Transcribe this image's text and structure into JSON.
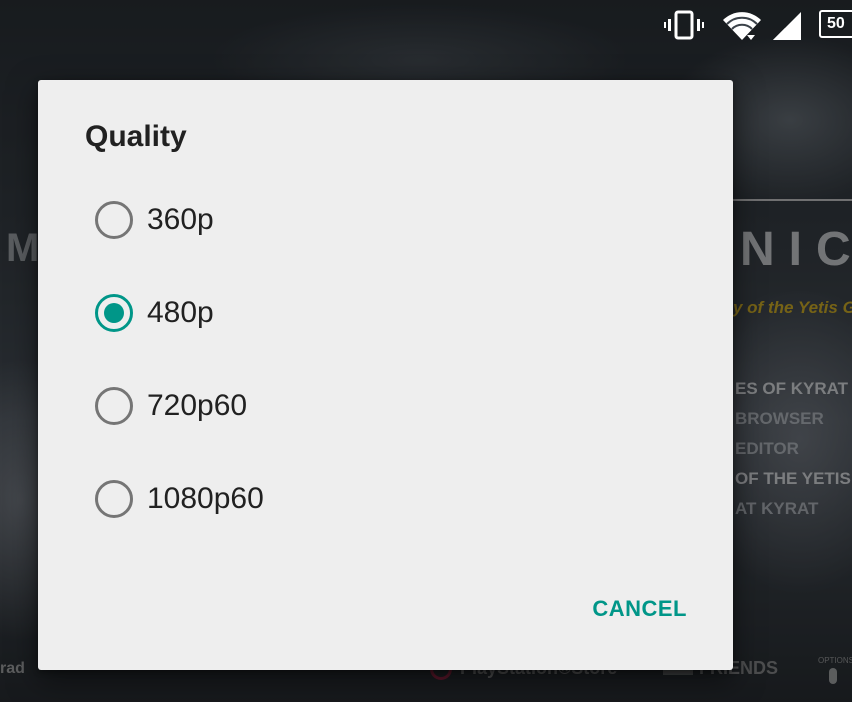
{
  "status_bar": {
    "battery_level": "50",
    "icons": [
      "vibrate-icon",
      "wifi-icon",
      "cell-signal-icon",
      "battery-icon"
    ]
  },
  "background": {
    "title_left": "M",
    "title_right": "NIC",
    "subtitle": "y of the Yetis G",
    "menu_items": [
      "ES OF KYRAT",
      "BROWSER",
      "EDITOR",
      "OF THE YETIS",
      "AT KYRAT"
    ],
    "bottom_left": "rad",
    "store_label": "PlayStation®Store",
    "friends_label": "FRIENDS",
    "options_label": "OPTIONS"
  },
  "dialog": {
    "title": "Quality",
    "options": [
      {
        "label": "360p",
        "selected": false
      },
      {
        "label": "480p",
        "selected": true
      },
      {
        "label": "720p60",
        "selected": false
      },
      {
        "label": "1080p60",
        "selected": false
      }
    ],
    "cancel_label": "CANCEL"
  },
  "colors": {
    "accent": "#009688",
    "dialog_background": "#eeeeee",
    "text_primary": "#212121",
    "radio_unchecked": "#757575",
    "subtitle_yellow": "#d8b429"
  }
}
